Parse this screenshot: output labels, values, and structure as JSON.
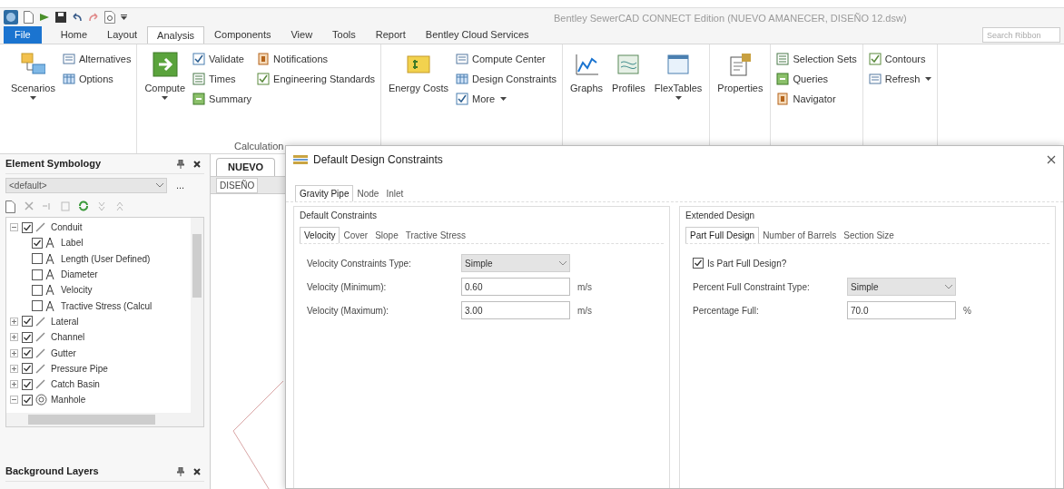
{
  "window": {
    "title": "Bentley SewerCAD CONNECT Edition (NUEVO AMANECER, DISEÑO 12.dsw)"
  },
  "ribbon_tabs": [
    {
      "label": "File",
      "kind": "file",
      "selected": false
    },
    {
      "label": "Home",
      "kind": "tab",
      "selected": false
    },
    {
      "label": "Layout",
      "kind": "tab",
      "selected": false
    },
    {
      "label": "Analysis",
      "kind": "tab",
      "selected": true
    },
    {
      "label": "Components",
      "kind": "tab",
      "selected": false
    },
    {
      "label": "View",
      "kind": "tab",
      "selected": false
    },
    {
      "label": "Tools",
      "kind": "tab",
      "selected": false
    },
    {
      "label": "Report",
      "kind": "tab",
      "selected": false
    },
    {
      "label": "Bentley Cloud Services",
      "kind": "tab",
      "selected": false
    }
  ],
  "search": {
    "placeholder": "Search Ribbon"
  },
  "ribbon_groups": [
    {
      "controls": [
        {
          "kind": "large",
          "label": "Scenarios",
          "menu": true
        },
        {
          "kind": "stack",
          "items": [
            {
              "label": "Alternatives",
              "menu": false
            },
            {
              "label": "Options",
              "menu": false
            }
          ]
        }
      ]
    },
    {
      "label": "Calculation",
      "controls": [
        {
          "kind": "large",
          "label": "Compute",
          "menu": true
        },
        {
          "kind": "stack",
          "items": [
            {
              "label": "Validate",
              "menu": false
            },
            {
              "label": "Times",
              "menu": false
            },
            {
              "label": "Summary",
              "menu": false
            }
          ]
        },
        {
          "kind": "stack",
          "items": [
            {
              "label": "Notifications",
              "menu": false
            },
            {
              "label": "Engineering Standards",
              "menu": false
            }
          ]
        }
      ]
    },
    {
      "controls": [
        {
          "kind": "large",
          "label": "Energy Costs",
          "menu": false
        },
        {
          "kind": "stack",
          "items": [
            {
              "label": "Compute Center",
              "menu": false
            },
            {
              "label": "Design Constraints",
              "menu": false
            },
            {
              "label": "More",
              "menu": true
            }
          ]
        }
      ]
    },
    {
      "controls": [
        {
          "kind": "large",
          "label": "Graphs",
          "menu": false
        },
        {
          "kind": "large",
          "label": "Profiles",
          "menu": false
        },
        {
          "kind": "large",
          "label": "FlexTables",
          "menu": true
        }
      ]
    },
    {
      "controls": [
        {
          "kind": "large",
          "label": "Properties",
          "menu": false
        }
      ]
    },
    {
      "controls": [
        {
          "kind": "stack",
          "items": [
            {
              "label": "Selection Sets",
              "menu": false
            },
            {
              "label": "Queries",
              "menu": false
            },
            {
              "label": "Navigator",
              "menu": false
            }
          ]
        }
      ]
    },
    {
      "controls": [
        {
          "kind": "stack",
          "items": [
            {
              "label": "Contours",
              "menu": false
            },
            {
              "label": "Refresh",
              "menu": true
            }
          ]
        }
      ]
    }
  ],
  "symbology_panel": {
    "title": "Element Symbology",
    "dropdown": "<default>",
    "more_button": "...",
    "tree": [
      {
        "label": "Conduit",
        "kind": "link",
        "checked": true,
        "expanded": true,
        "children": [
          {
            "label": "Label",
            "kind": "label",
            "checked": true
          },
          {
            "label": "Length (User Defined)",
            "kind": "label",
            "checked": false
          },
          {
            "label": "Diameter",
            "kind": "label",
            "checked": false
          },
          {
            "label": "Velocity",
            "kind": "label",
            "checked": false
          },
          {
            "label": "Tractive Stress (Calcul",
            "kind": "label",
            "checked": false
          }
        ]
      },
      {
        "label": "Lateral",
        "kind": "link",
        "checked": true,
        "expanded": false
      },
      {
        "label": "Channel",
        "kind": "link",
        "checked": true,
        "expanded": false
      },
      {
        "label": "Gutter",
        "kind": "link",
        "checked": true,
        "expanded": false
      },
      {
        "label": "Pressure Pipe",
        "kind": "link",
        "checked": true,
        "expanded": false
      },
      {
        "label": "Catch Basin",
        "kind": "link",
        "checked": true,
        "expanded": false
      },
      {
        "label": "Manhole",
        "kind": "node",
        "checked": true,
        "expanded": true
      }
    ]
  },
  "layers_panel": {
    "title": "Background Layers"
  },
  "document": {
    "tab": "NUEVO",
    "view_tab": "DISEÑO"
  },
  "dialog": {
    "title": "Default Design Constraints",
    "tabs": [
      {
        "label": "Gravity Pipe",
        "selected": true
      },
      {
        "label": "Node",
        "selected": false
      },
      {
        "label": "Inlet",
        "selected": false
      }
    ],
    "groups": [
      {
        "title": "Default Constraints",
        "tabs": [
          {
            "label": "Velocity",
            "selected": true
          },
          {
            "label": "Cover",
            "selected": false
          },
          {
            "label": "Slope",
            "selected": false
          },
          {
            "label": "Tractive Stress",
            "selected": false
          }
        ],
        "fields": [
          {
            "kind": "select",
            "label": "Velocity Constraints Type:",
            "value": "Simple"
          },
          {
            "kind": "input",
            "label": "Velocity (Minimum):",
            "value": "0.60",
            "unit": "m/s"
          },
          {
            "kind": "input",
            "label": "Velocity (Maximum):",
            "value": "3.00",
            "unit": "m/s"
          }
        ]
      },
      {
        "title": "Extended Design",
        "tabs": [
          {
            "label": "Part Full Design",
            "selected": true
          },
          {
            "label": "Number of Barrels",
            "selected": false
          },
          {
            "label": "Section Size",
            "selected": false
          }
        ],
        "fields": [
          {
            "kind": "checkbox",
            "label": "Is Part Full Design?",
            "checked": true
          },
          {
            "kind": "select",
            "label": "Percent Full Constraint Type:",
            "value": "Simple"
          },
          {
            "kind": "input",
            "label": "Percentage Full:",
            "value": "70.0",
            "unit": "%"
          }
        ]
      }
    ]
  }
}
